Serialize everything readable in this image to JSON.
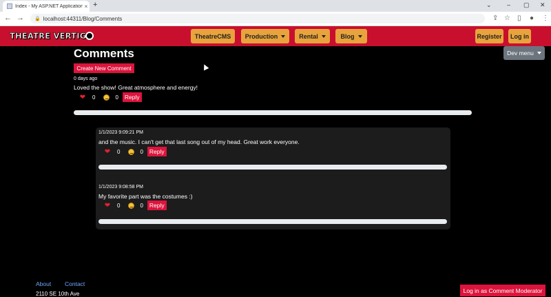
{
  "browser": {
    "tab_title": "Index - My ASP.NET Application",
    "tab_close": "×",
    "new_tab": "+",
    "url": "localhost:44311/Blog/Comments",
    "back": "←",
    "forward": "→",
    "reload": "⟳",
    "lock": "🔒",
    "share": "⇪",
    "star": "☆",
    "side_panel": "▯",
    "profile": "●",
    "menu": "⋮",
    "minimize": "–",
    "maximize": "▢",
    "close": "✕",
    "chevron": "⌄"
  },
  "navbar": {
    "brand_left": "THEATRE VERTIG",
    "items": [
      {
        "label": "TheatreCMS",
        "dropdown": false
      },
      {
        "label": "Production",
        "dropdown": true
      },
      {
        "label": "Rental",
        "dropdown": true
      },
      {
        "label": "Blog",
        "dropdown": true
      }
    ],
    "register": "Register",
    "login": "Log in",
    "dev_menu": "Dev menu"
  },
  "main": {
    "title": "Comments",
    "create_button": "Create New Comment",
    "comment": {
      "timestamp": "0 days ago",
      "text": "Loved the show! Great atmosphere and energy!",
      "likes": "0",
      "dislikes": "0",
      "reply_label": "Reply"
    },
    "replies": [
      {
        "timestamp": "1/1/2023 9:09:21 PM",
        "text": "and the music. I can't get that last song out of my head. Great work everyone.",
        "likes": "0",
        "dislikes": "0",
        "reply_label": "Reply"
      },
      {
        "timestamp": "1/1/2023 9:08:58 PM",
        "text": "My favorite part was the costumes :)",
        "likes": "0",
        "dislikes": "0",
        "reply_label": "Reply"
      }
    ]
  },
  "footer": {
    "about": "About",
    "contact": "Contact",
    "address": "2110 SE 10th Ave",
    "moderator_button": "Log in as Comment Moderator"
  },
  "icons": {
    "heart": "heart-icon",
    "emoji": "sad-emoji-icon"
  },
  "colors": {
    "brand_red": "#c8102e",
    "button_red": "#dc143c",
    "nav_button": "#e8a33c",
    "dev_menu": "#6c757d"
  }
}
